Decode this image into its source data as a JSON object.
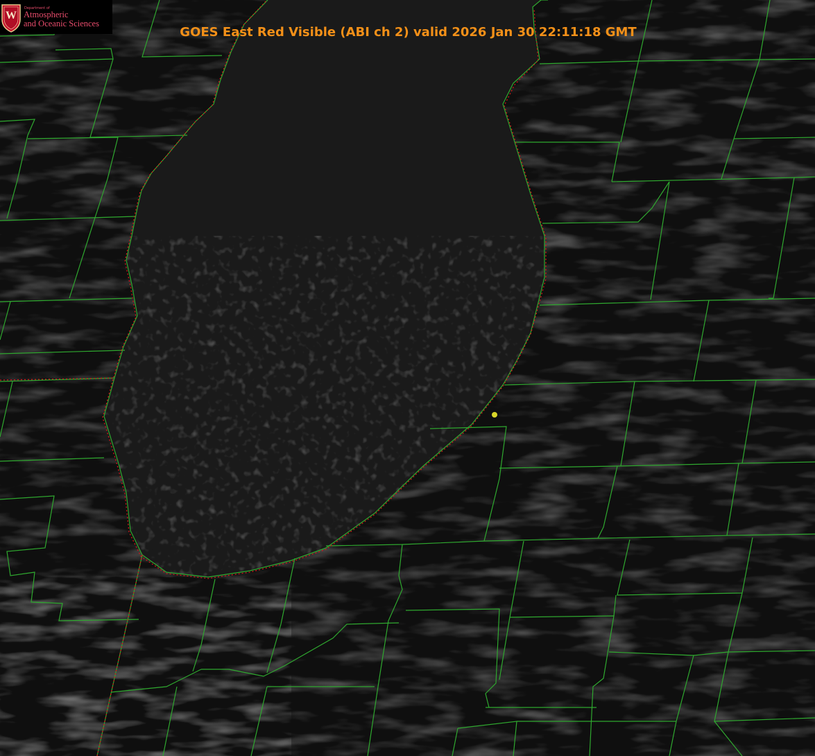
{
  "title": "GOES East Red Visible (ABI ch 2) valid 2026 Jan 30 22:11:18 GMT",
  "logo": {
    "department": "Department of",
    "line1": "Atmospheric",
    "line2": "and Oceanic Sciences",
    "crest_letter": "W"
  },
  "colors": {
    "background": "#0f0f0f",
    "lake": "#1d1d1d",
    "county_lines": "#2fa82f",
    "shoreline": "#d11919",
    "title": "#f39018",
    "logo_text": "#e84c6c",
    "marker": "#d9d62a"
  },
  "icons": {
    "crest": "wisconsin-crest-icon",
    "marker": "location-dot-icon"
  }
}
